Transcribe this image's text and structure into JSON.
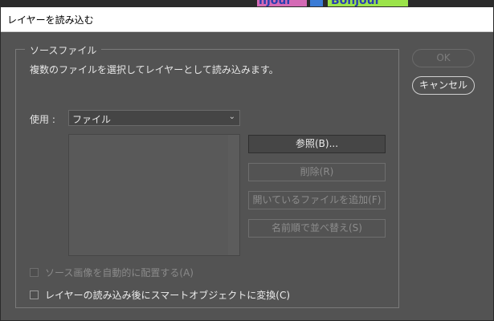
{
  "background": {
    "text_left": "njour",
    "text_right": "Bonjour"
  },
  "dialog": {
    "title": "レイヤーを読み込む",
    "group_label": "ソースファイル",
    "description": "複数のファイルを選択してレイヤーとして読み込みます。",
    "use_label": "使用 :",
    "use_value": "ファイル",
    "buttons": {
      "browse": "参照(B)...",
      "delete": "削除(R)",
      "add_open": "開いているファイルを追加(F)",
      "sort": "名前順で並べ替え(S)",
      "ok": "OK",
      "cancel": "キャンセル"
    },
    "checkboxes": {
      "auto_align": "ソース画像を自動的に配置する(A)",
      "smart_object": "レイヤーの読み込み後にスマートオブジェクトに変換(C)"
    }
  }
}
